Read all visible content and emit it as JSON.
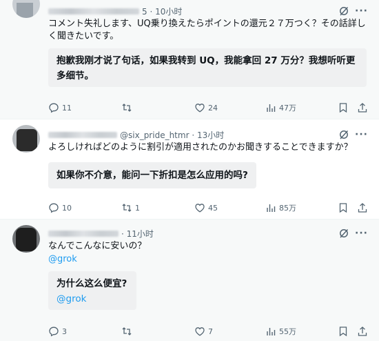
{
  "posts": [
    {
      "time": "5 · 10小时",
      "text": "コメント失礼します、UQ乗り換えたらポイントの還元２７万つく？その話詳しく聞きたいです。",
      "mention": "",
      "translation": "抱歉我刚才说了句话，如果我转到 UQ，我能拿回 27 万分？我想听听更多细节。",
      "translation_mention": "",
      "replies": "11",
      "reposts": "",
      "likes": "24",
      "views": "47万"
    },
    {
      "handle": "@six_pride_htmr · 13小时",
      "text": "よろしければどのように割引が適用されたのかお聞きすることできますか？",
      "mention": "",
      "translation": "如果你不介意，能问一下折扣是怎么应用的吗?",
      "translation_mention": "",
      "replies": "10",
      "reposts": "1",
      "likes": "45",
      "views": "85万"
    },
    {
      "time": "· 11小时",
      "text": "なんでこんなに安いの？",
      "mention": "@grok",
      "translation": "为什么这么便宜?",
      "translation_mention": "@grok",
      "replies": "3",
      "reposts": "",
      "likes": "7",
      "views": "55万"
    }
  ],
  "icons": {
    "reply": "reply-icon",
    "repost": "repost-icon",
    "like": "like-icon",
    "views": "views-icon",
    "bookmark": "bookmark-icon",
    "share": "share-icon",
    "grok": "grok-icon",
    "more": "more-icon"
  },
  "colors": {
    "accent": "#1d9bf0",
    "secondary_text": "#536471",
    "translation_bg": "#eff0f1"
  }
}
